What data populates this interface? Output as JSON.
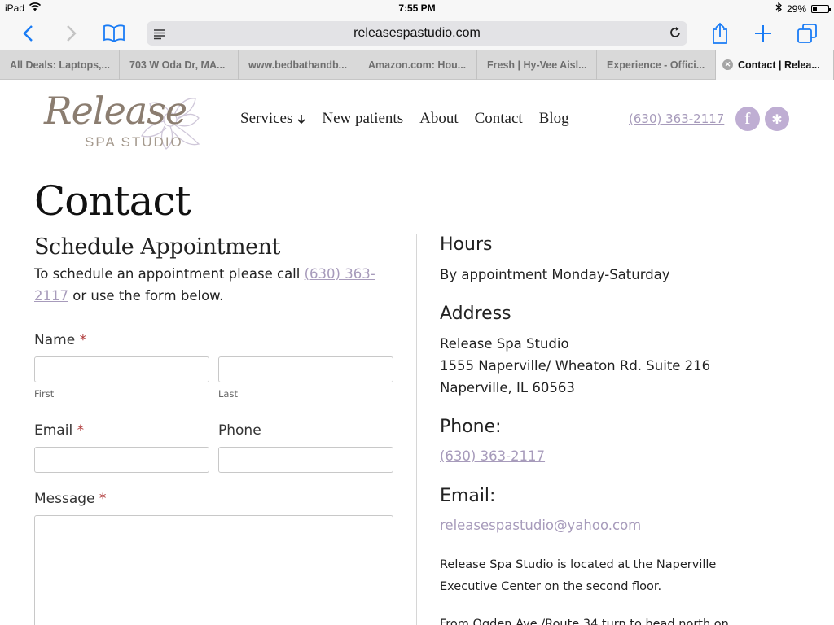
{
  "status": {
    "device": "iPad",
    "time": "7:55 PM",
    "battery": "29%",
    "battery_level": 0.29
  },
  "browser": {
    "url": "releasespastudio.com",
    "tabs": [
      "All Deals: Laptops,...",
      "703 W Oda Dr, MA...",
      "www.bedbathandb...",
      "Amazon.com: Hou...",
      "Fresh | Hy-Vee Aisl...",
      "Experience - Offici...",
      "Contact | Relea..."
    ]
  },
  "site": {
    "logo_script": "Release",
    "logo_sub": "SPA STUDIO",
    "nav": [
      "Services",
      "New patients",
      "About",
      "Contact",
      "Blog"
    ],
    "header_phone": "(630) 363-2117",
    "social": {
      "facebook": "f",
      "yelp": "✱"
    }
  },
  "page": {
    "title": "Contact",
    "schedule_heading": "Schedule Appointment",
    "intro_before": "To schedule an appointment please call ",
    "intro_phone": "(630) 363-2117",
    "intro_after": " or use the form below.",
    "form": {
      "name_label": "Name",
      "required_mark": "*",
      "first_label": "First",
      "last_label": "Last",
      "email_label": "Email",
      "phone_label": "Phone",
      "message_label": "Message"
    },
    "info": {
      "hours_heading": "Hours",
      "hours_text": "By appointment Monday-Saturday",
      "address_heading": "Address",
      "address_line1": "Release Spa Studio",
      "address_line2": "1555 Naperville/ Wheaton Rd. Suite 216",
      "address_line3": "Naperville, IL 60563",
      "phone_heading": "Phone:",
      "phone_value": "(630) 363-2117",
      "email_heading": "Email:",
      "email_value": "releasespastudio@yahoo.com",
      "location_line1": "Release Spa Studio is located at the Naperville",
      "location_line2": "Executive Center on the second floor.",
      "directions_partial": "From Ogden Ave./Route 34 turn to head north on"
    }
  }
}
